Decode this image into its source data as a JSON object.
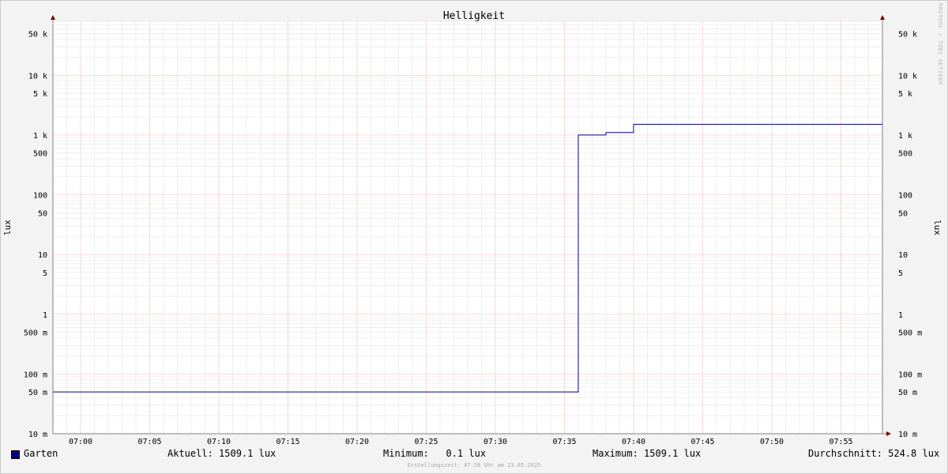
{
  "chart_data": {
    "type": "line",
    "title": "Helligkeit",
    "ylabel": "lux",
    "y_scale": "log",
    "ylim": [
      0.01,
      80000
    ],
    "xlim": [
      "06:58",
      "07:58"
    ],
    "x_ticks": [
      "07:00",
      "07:05",
      "07:10",
      "07:15",
      "07:20",
      "07:25",
      "07:30",
      "07:35",
      "07:40",
      "07:45",
      "07:50",
      "07:55"
    ],
    "y_ticks": [
      {
        "value": 50000,
        "label": "50 k"
      },
      {
        "value": 10000,
        "label": "10 k"
      },
      {
        "value": 5000,
        "label": "5 k"
      },
      {
        "value": 1000,
        "label": "1 k"
      },
      {
        "value": 500,
        "label": "500"
      },
      {
        "value": 100,
        "label": "100"
      },
      {
        "value": 50,
        "label": "50"
      },
      {
        "value": 10,
        "label": "10"
      },
      {
        "value": 5,
        "label": "5"
      },
      {
        "value": 1,
        "label": "1"
      },
      {
        "value": 0.5,
        "label": "500 m"
      },
      {
        "value": 0.1,
        "label": "100 m"
      },
      {
        "value": 0.05,
        "label": "50 m"
      },
      {
        "value": 0.01,
        "label": "10 m"
      }
    ],
    "grid": true,
    "series": [
      {
        "name": "Garten",
        "color": "#000080",
        "step": true,
        "x": [
          "06:58",
          "07:36",
          "07:38",
          "07:40",
          "07:58"
        ],
        "y": [
          0.05,
          1000,
          1100,
          1509.1,
          1509.1
        ]
      }
    ]
  },
  "legend": {
    "series_name": "Garten",
    "current": "Aktuell: 1509.1 lux",
    "minimum": "Minimum:   0.1 lux",
    "maximum": "Maximum: 1509.1 lux",
    "average": "Durchschnitt: 524.8 lux"
  },
  "watermark": "RRDTOOL / TOBI OETIKER",
  "footer": "Erstellungszeit: 07:58 Uhr am 23.05.2025",
  "colors": {
    "series": "#000080",
    "minor_grid": "#d8d8d8",
    "major_grid": "#f0a0a0",
    "axis": "#808080",
    "arrow": "#800000"
  }
}
